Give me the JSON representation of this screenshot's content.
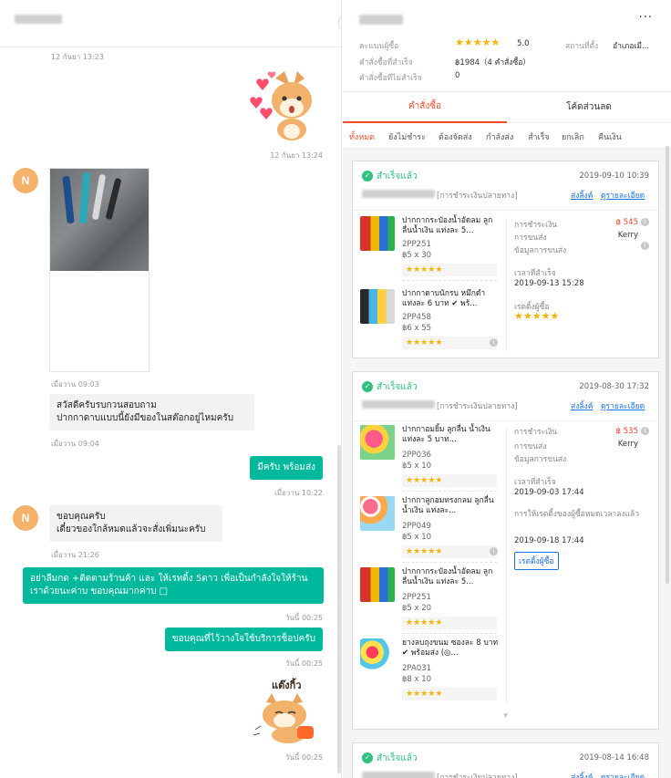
{
  "chat": {
    "header_name": "",
    "time1": "12 กันยา 13:23",
    "time2": "12 กันยา 13:24",
    "avatar_letter": "N",
    "time3": "เมื่อวาน 09:03",
    "msg_in1": "สวัสดีครับรบกวนสอบถาม\nปากกาดาบแบบนี้ยังมีของในสต๊อกอยู่ไหมครับ",
    "time4": "เมื่อวาน 09:04",
    "msg_out1": "มีครับ พร้อมส่ง",
    "time5": "เมื่อวาน 10:22",
    "msg_in2": "ขอบคุณครับ\nเดี๋ยวของใกล้หมดแล้วจะสั่งเพิ่มนะครับ",
    "time6": "เมื่อวาน 21:26",
    "msg_out2": "อย่าลืมกด +ติดตามร้านค้า และ ให้เรทติ้ง 5ดาว เพื่อเป็นกำลังใจให้ร้าน เราด้วยนะค่าบ ขอบคุณมากค่าบ □",
    "time7": "วันนี้ 00:25",
    "msg_out3": "ขอบคุณที่ไว้วางใจใช้บริการช็อปครับ",
    "time8": "วันนี้ 00:25",
    "sticker_text": "แต๊งกิ้ว",
    "time9": "วันนี้ 00:25"
  },
  "profile": {
    "more": "···",
    "rating_label": "คะแนนผู้ซื้อ",
    "rating_stars": "★★★★★",
    "rating_value": "5.0",
    "location_label": "สถานที่ตั้ง",
    "location_value": "อำเภอเมื...",
    "success_label": "คำสั่งซื้อที่สำเร็จ",
    "success_value": "฿1984（4 คำสั่งซื้อ）",
    "fail_label": "คำสั่งซื้อที่ไม่สำเร็จ",
    "fail_value": "0"
  },
  "tabs": [
    "คำสั่งซื้อ",
    "โค้ดส่วนลด"
  ],
  "subtabs": [
    "ทั้งหมด",
    "ยังไม่ชำระ",
    "ต้องจัดส่ง",
    "กำลังส่ง",
    "สำเร็จ",
    "ยกเลิก",
    "คืนเงิน"
  ],
  "labels": {
    "status": "สำเร็จแล้ว",
    "pay_method": "[การชำระเงินปลายทาง]",
    "track": "ส่งลิ้งค์",
    "detail": "ดูรายละเอียด",
    "payment": "การชำระเงิน",
    "shipping": "การขนส่ง",
    "shipping_info": "ข้อมูลการขนส่ง",
    "done_time": "เวลาที่สำเร็จ",
    "buyer_rating": "เรตติ้งผู้ซื้อ",
    "rating_expired": "การให้เรตติ้งของผู้ซื้อหมดเวลาลงแล้ว",
    "rate_buyer_btn": "เรตติ้งผู้ซื้อ",
    "stars": "★★★★★",
    "info": "i",
    "check": "✓",
    "chevron": "▾"
  },
  "orders": [
    {
      "date": "2019-09-10 10:39",
      "price": "฿ 545",
      "carrier": "Kerry",
      "done": "2019-09-13 15:28",
      "items": [
        {
          "name": "ปากกากระป๋องน้ำอัดลม ลูกลื่นน้ำเงิน แท่งละ 5...",
          "code": "2PP251",
          "qty": "฿5 x 30"
        },
        {
          "name": "ปากกาดาบนักรบ หมึกดำ แท่งละ 6 บาท ✔ พร้...",
          "code": "2PP458",
          "qty": "฿6 x 55"
        }
      ]
    },
    {
      "date": "2019-08-30 17:32",
      "price": "฿ 535",
      "carrier": "Kerry",
      "done": "2019-09-03 17:44",
      "expire": "2019-09-18 17:44",
      "items": [
        {
          "name": "ปากกาอมยิ้ม ลูกลื่น น้ำเงิน แท่งละ 5 บาท...",
          "code": "2PP036",
          "qty": "฿5 x 10"
        },
        {
          "name": "ปากกาลูกอมทรงกลม ลูกลื่นน้ำเงิน แท่งละ...",
          "code": "2PP049",
          "qty": "฿5 x 10"
        },
        {
          "name": "ปากกากระป๋องน้ำอัดลม ลูกลื่นน้ำเงิน แท่งละ 5...",
          "code": "2PP251",
          "qty": "฿5 x 20"
        },
        {
          "name": "ยางลบถุงขนม ซองละ 8 บาท ✔ พร้อมส่ง (◎...",
          "code": "2PA031",
          "qty": "฿8 x 10"
        }
      ]
    },
    {
      "date": "2019-08-14 16:48"
    }
  ],
  "colors": {
    "accent": "#ee4d2d",
    "chat_green": "#00b89c",
    "success": "#2ec27e",
    "link": "#1a73e8",
    "star": "#f5b400"
  }
}
